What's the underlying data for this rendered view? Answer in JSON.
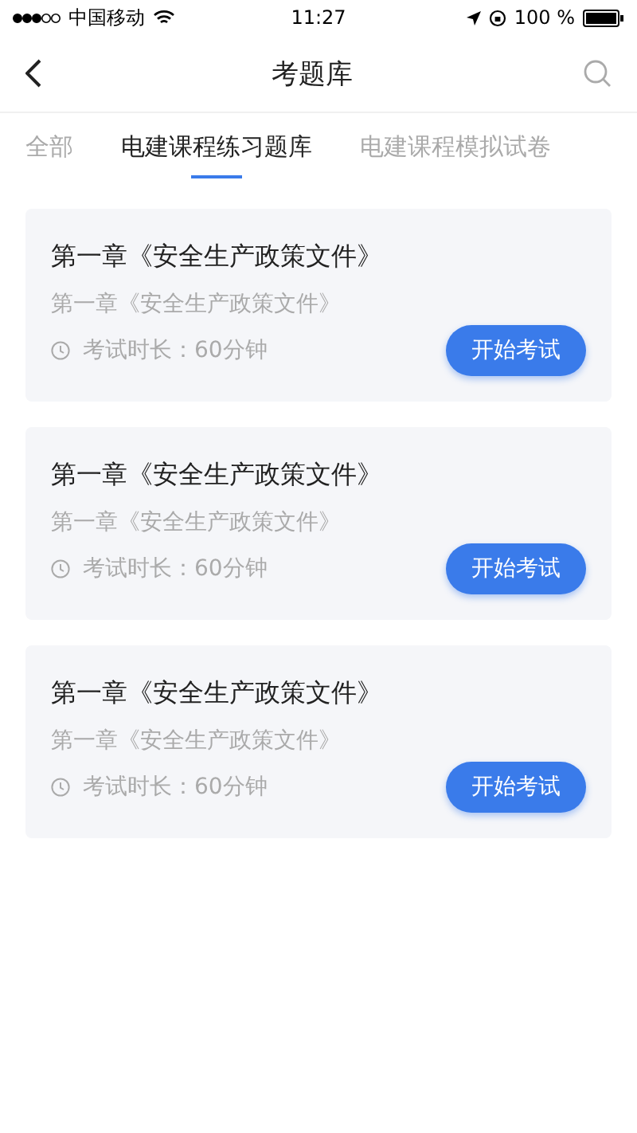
{
  "status_bar": {
    "carrier": "中国移动",
    "time": "11:27",
    "battery": "100 %"
  },
  "nav": {
    "title": "考题库"
  },
  "tabs": [
    {
      "label": "全部",
      "selected": false
    },
    {
      "label": "电建课程练习题库",
      "selected": true
    },
    {
      "label": "电建课程模拟试卷",
      "selected": false
    }
  ],
  "exams": [
    {
      "title": "第一章《安全生产政策文件》",
      "subtitle": "第一章《安全生产政策文件》",
      "duration": "考试时长：60分钟",
      "button": "开始考试"
    },
    {
      "title": "第一章《安全生产政策文件》",
      "subtitle": "第一章《安全生产政策文件》",
      "duration": "考试时长：60分钟",
      "button": "开始考试"
    },
    {
      "title": "第一章《安全生产政策文件》",
      "subtitle": "第一章《安全生产政策文件》",
      "duration": "考试时长：60分钟",
      "button": "开始考试"
    }
  ]
}
